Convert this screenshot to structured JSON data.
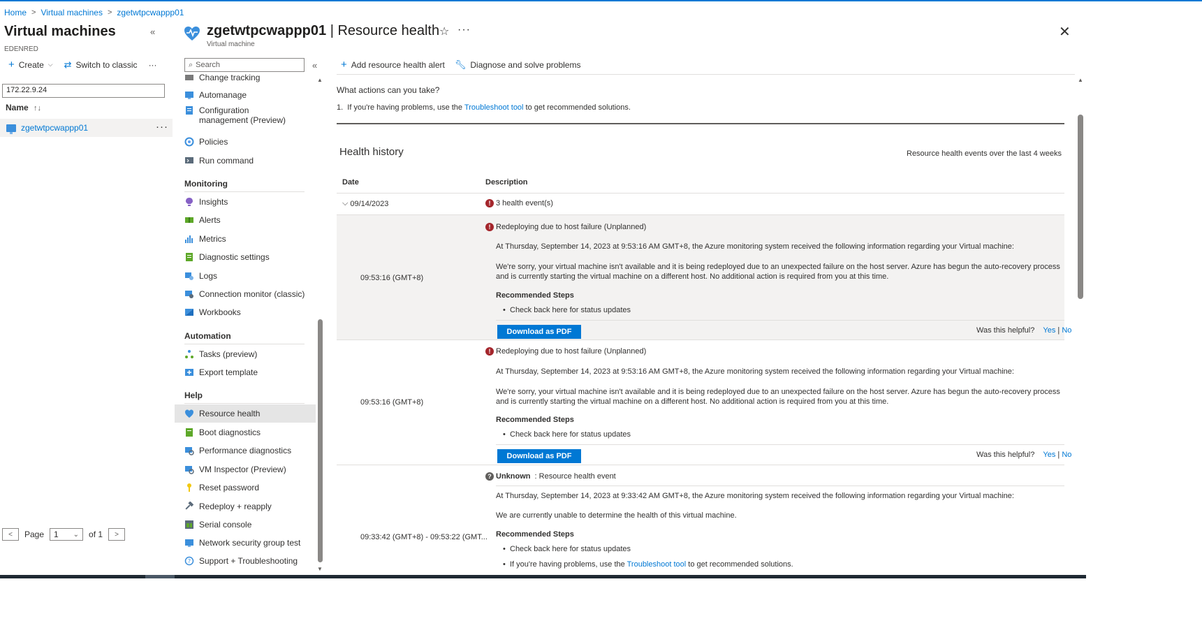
{
  "breadcrumb": [
    "Home",
    "Virtual machines",
    "zgetwtpcwappp01"
  ],
  "left_pane": {
    "title": "Virtual machines",
    "subtitle": "EDENRED",
    "commands": {
      "create": "Create",
      "switch": "Switch to classic"
    },
    "filter_value": "172.22.9.24",
    "column_header": "Name",
    "rows": [
      {
        "name": "zgetwtpcwappp01"
      }
    ],
    "pager": {
      "page_label": "Page",
      "page_value": "1",
      "of_label": "of 1"
    }
  },
  "resource": {
    "name": "zgetwtpcwappp01",
    "section": "Resource health",
    "type": "Virtual machine"
  },
  "menu": {
    "search_placeholder": "Search",
    "items_top": [
      {
        "label": "Change tracking",
        "icon": "change-tracking-icon"
      },
      {
        "label": "Automanage",
        "icon": "automanage-icon"
      },
      {
        "label": "Configuration management (Preview)",
        "icon": "configuration-icon"
      },
      {
        "label": "Policies",
        "icon": "policies-icon"
      },
      {
        "label": "Run command",
        "icon": "run-command-icon"
      }
    ],
    "monitoring_title": "Monitoring",
    "monitoring": [
      {
        "label": "Insights",
        "icon": "insights-icon"
      },
      {
        "label": "Alerts",
        "icon": "alerts-icon"
      },
      {
        "label": "Metrics",
        "icon": "metrics-icon"
      },
      {
        "label": "Diagnostic settings",
        "icon": "diagnostic-settings-icon"
      },
      {
        "label": "Logs",
        "icon": "logs-icon"
      },
      {
        "label": "Connection monitor (classic)",
        "icon": "connection-monitor-icon"
      },
      {
        "label": "Workbooks",
        "icon": "workbooks-icon"
      }
    ],
    "automation_title": "Automation",
    "automation": [
      {
        "label": "Tasks (preview)",
        "icon": "tasks-icon"
      },
      {
        "label": "Export template",
        "icon": "export-template-icon"
      }
    ],
    "help_title": "Help",
    "help": [
      {
        "label": "Resource health",
        "icon": "resource-health-icon"
      },
      {
        "label": "Boot diagnostics",
        "icon": "boot-diagnostics-icon"
      },
      {
        "label": "Performance diagnostics",
        "icon": "performance-diagnostics-icon"
      },
      {
        "label": "VM Inspector (Preview)",
        "icon": "vm-inspector-icon"
      },
      {
        "label": "Reset password",
        "icon": "key-icon"
      },
      {
        "label": "Redeploy + reapply",
        "icon": "hammer-icon"
      },
      {
        "label": "Serial console",
        "icon": "serial-console-icon"
      },
      {
        "label": "Network security group test",
        "icon": "nsg-test-icon"
      },
      {
        "label": "Support + Troubleshooting",
        "icon": "support-icon"
      }
    ]
  },
  "content": {
    "commands": {
      "add_alert": "Add resource health alert",
      "diagnose": "Diagnose and solve problems"
    },
    "question": "What actions can you take?",
    "action_prefix": "1.  If you're having problems, use the ",
    "action_link": "Troubleshoot tool",
    "action_suffix": " to get recommended solutions.",
    "history_title": "Health history",
    "history_note": "Resource health events over the last 4 weeks",
    "col_date": "Date",
    "col_description": "Description",
    "group_date": "09/14/2023",
    "group_summary": "3 health event(s)",
    "events": [
      {
        "time": "09:53:16 (GMT+8)",
        "title": "Redeploying due to host failure (Unplanned)",
        "info": "At Thursday, September 14, 2023 at 9:53:16 AM GMT+8, the Azure monitoring system received the following information regarding your Virtual machine:",
        "detail": "We're sorry, your virtual machine isn't available and it is being redeployed due to an unexpected failure on the host server. Azure has begun the auto-recovery process and is currently starting the virtual machine on a different host. No additional action is required from you at this time.",
        "steps_title": "Recommended Steps",
        "step": "Check back here for status updates",
        "pdf": "Download as PDF",
        "helpful": "Was this helpful?",
        "yes": "Yes",
        "no": "No"
      },
      {
        "time": "09:53:16 (GMT+8)",
        "title": "Redeploying due to host failure (Unplanned)",
        "info": "At Thursday, September 14, 2023 at 9:53:16 AM GMT+8, the Azure monitoring system received the following information regarding your Virtual machine:",
        "detail": "We're sorry, your virtual machine isn't available and it is being redeployed due to an unexpected failure on the host server. Azure has begun the auto-recovery process and is currently starting the virtual machine on a different host. No additional action is required from you at this time.",
        "steps_title": "Recommended Steps",
        "step": "Check back here for status updates",
        "pdf": "Download as PDF",
        "helpful": "Was this helpful?",
        "yes": "Yes",
        "no": "No"
      },
      {
        "time": "09:33:42 (GMT+8) - 09:53:22 (GMT...",
        "title_bold": "Unknown",
        "title_rest": " : Resource health event",
        "info": "At Thursday, September 14, 2023 at 9:33:42 AM GMT+8, the Azure monitoring system received the following information regarding your Virtual machine:",
        "detail": "We are currently unable to determine the health of this virtual machine.",
        "steps_title": "Recommended Steps",
        "step": "Check back here for status updates",
        "step2_prefix": "If you're having problems, use the ",
        "step2_link": "Troubleshoot tool",
        "step2_suffix": " to get recommended solutions."
      }
    ]
  },
  "colors": {
    "accent": "#0078d4",
    "error": "#a4262c",
    "selected": "#e5e5e5",
    "shaded": "#f3f2f1"
  }
}
